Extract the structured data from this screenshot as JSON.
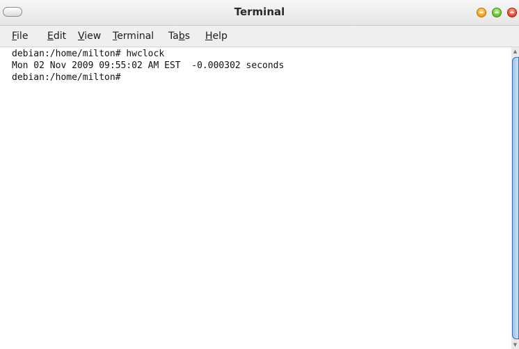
{
  "window": {
    "title": "Terminal"
  },
  "menu": {
    "items": [
      {
        "mnemonic": "F",
        "rest": "ile"
      },
      {
        "mnemonic": "E",
        "rest": "dit"
      },
      {
        "mnemonic": "V",
        "rest": "iew"
      },
      {
        "mnemonic": "T",
        "rest": "erminal"
      },
      {
        "pre": "Ta",
        "mnemonic": "b",
        "rest": "s"
      },
      {
        "mnemonic": "H",
        "rest": "elp"
      }
    ]
  },
  "terminal": {
    "lines": [
      "debian:/home/milton# hwclock",
      "Mon 02 Nov 2009 09:55:02 AM EST  -0.000302 seconds",
      "debian:/home/milton#"
    ]
  },
  "scrollbar": {
    "up_glyph": "▲",
    "down_glyph": "▼"
  }
}
